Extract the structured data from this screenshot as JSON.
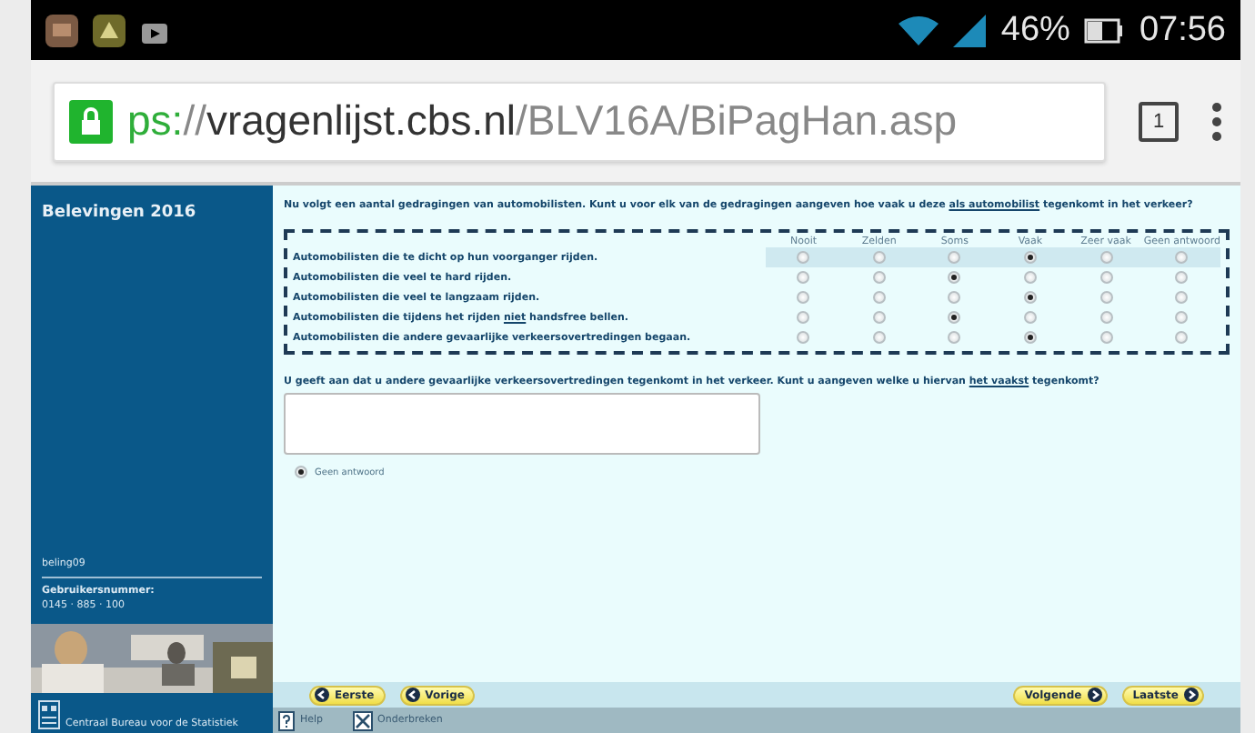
{
  "status_bar": {
    "battery": "46%",
    "time": "07:56"
  },
  "browser": {
    "url_parts": [
      {
        "kind": "scheme",
        "text": "ps:"
      },
      {
        "kind": "sep",
        "text": "//"
      },
      {
        "kind": "host",
        "text": "vragenlijst.cbs.nl"
      },
      {
        "kind": "path",
        "text": "/BLV16A/BiPagHan.asp"
      }
    ],
    "tab_count": "1"
  },
  "sidebar": {
    "title": "Belevingen 2016",
    "page_code": "beling09",
    "user_label": "Gebruikersnummer:",
    "user_number": "0145 · 885 · 100",
    "org": "Centraal Bureau voor de Statistiek"
  },
  "question1": {
    "parts": [
      {
        "text": "Nu volgt een aantal gedragingen van automobilisten. Kunt u voor elk van de gedragingen aangeven hoe vaak u deze ",
        "underlined": false
      },
      {
        "text": "als automobilist",
        "underlined": true
      },
      {
        "text": " tegenkomt in het verkeer?",
        "underlined": false
      }
    ],
    "columns": [
      "Nooit",
      "Zelden",
      "Soms",
      "Vaak",
      "Zeer vaak",
      "Geen antwoord"
    ],
    "rows": [
      {
        "parts": [
          {
            "text": "Automobilisten die te dicht op hun voorganger rijden.",
            "underlined": false
          }
        ],
        "highlighted": true,
        "options": [
          {
            "selected": false
          },
          {
            "selected": false
          },
          {
            "selected": false
          },
          {
            "selected": true
          },
          {
            "selected": false
          },
          {
            "selected": false
          }
        ]
      },
      {
        "parts": [
          {
            "text": "Automobilisten die veel te hard rijden.",
            "underlined": false
          }
        ],
        "highlighted": false,
        "options": [
          {
            "selected": false
          },
          {
            "selected": false
          },
          {
            "selected": true
          },
          {
            "selected": false
          },
          {
            "selected": false
          },
          {
            "selected": false
          }
        ]
      },
      {
        "parts": [
          {
            "text": "Automobilisten die veel te langzaam rijden.",
            "underlined": false
          }
        ],
        "highlighted": false,
        "options": [
          {
            "selected": false
          },
          {
            "selected": false
          },
          {
            "selected": false
          },
          {
            "selected": true
          },
          {
            "selected": false
          },
          {
            "selected": false
          }
        ]
      },
      {
        "parts": [
          {
            "text": "Automobilisten die tijdens het rijden ",
            "underlined": false
          },
          {
            "text": "niet",
            "underlined": true
          },
          {
            "text": " handsfree bellen.",
            "underlined": false
          }
        ],
        "highlighted": false,
        "options": [
          {
            "selected": false
          },
          {
            "selected": false
          },
          {
            "selected": true
          },
          {
            "selected": false
          },
          {
            "selected": false
          },
          {
            "selected": false
          }
        ]
      },
      {
        "parts": [
          {
            "text": "Automobilisten die andere gevaarlijke verkeersovertredingen begaan.",
            "underlined": false
          }
        ],
        "highlighted": false,
        "options": [
          {
            "selected": false
          },
          {
            "selected": false
          },
          {
            "selected": false
          },
          {
            "selected": true
          },
          {
            "selected": false
          },
          {
            "selected": false
          }
        ]
      }
    ]
  },
  "question2": {
    "parts": [
      {
        "text": "U geeft aan dat u andere gevaarlijke verkeersovertredingen tegenkomt in het verkeer. Kunt u aangeven welke u hiervan ",
        "underlined": false
      },
      {
        "text": "het vaakst",
        "underlined": true
      },
      {
        "text": " tegenkomt?",
        "underlined": false
      }
    ],
    "no_answer": {
      "label": "Geen antwoord",
      "selected": true
    }
  },
  "nav": {
    "left": [
      {
        "label": "Eerste"
      },
      {
        "label": "Vorige"
      }
    ],
    "right": [
      {
        "label": "Volgende"
      },
      {
        "label": "Laatste"
      }
    ]
  },
  "toolbar": [
    {
      "kind": "help",
      "label": "Help"
    },
    {
      "kind": "interrupt",
      "label": "Onderbreken"
    }
  ]
}
